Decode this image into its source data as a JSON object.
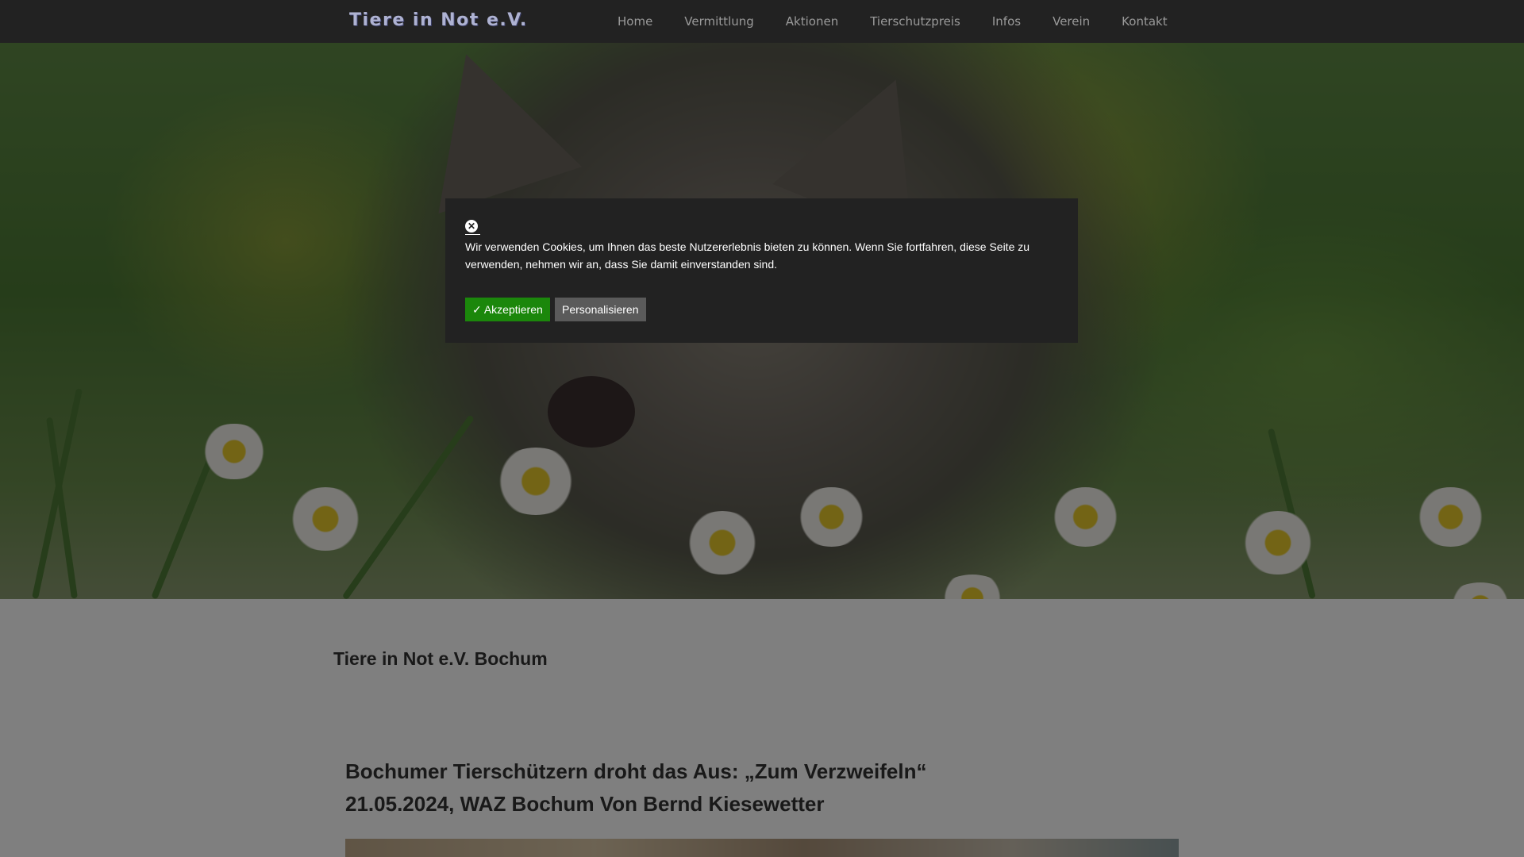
{
  "header": {
    "logo": "Tiere in Not e.V.",
    "nav": [
      "Home",
      "Vermittlung",
      "Aktionen",
      "Tierschutzpreis",
      "Infos",
      "Verein",
      "Kontakt"
    ]
  },
  "site_subtitle": "Tiere in Not e.V. Bochum",
  "article": {
    "title_line1": "Bochumer Tierschützern droht das Aus: „Zum Verzweifeln“",
    "title_line2": "21.05.2024, WAZ Bochum Von Bernd Kiesewetter"
  },
  "cookie_banner": {
    "close_icon": "✕",
    "text": "Wir verwenden Cookies, um Ihnen das beste Nutzererlebnis bieten zu können. Wenn Sie fortfahren, diese Seite zu verwenden, nehmen wir an, dass Sie damit einverstanden sind.",
    "accept_label": "✓ Akzeptieren",
    "personalize_label": "Personalisieren"
  },
  "icons": {
    "cookie_close": "close-circle-icon"
  },
  "colors": {
    "topbar": "#222222",
    "logo": "#aeb2d2",
    "nav_text": "#9a9a9a",
    "accept_button": "#1b870b",
    "personalize_button": "#5a5a5a",
    "banner_background": "#222222"
  }
}
